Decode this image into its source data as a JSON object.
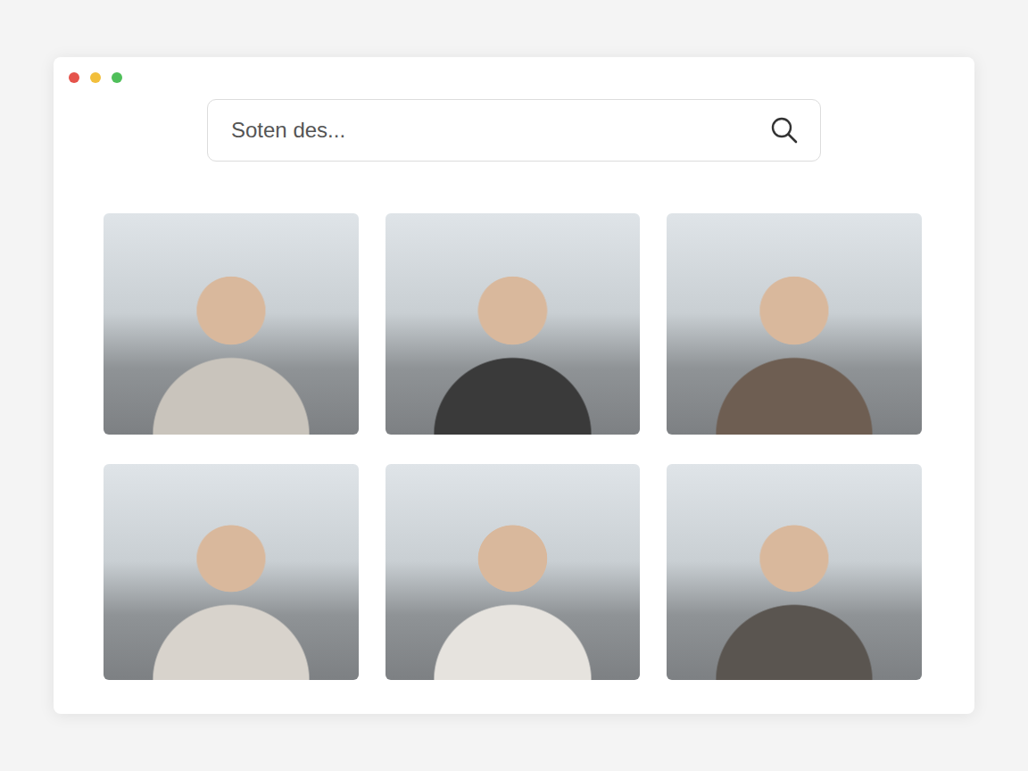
{
  "search": {
    "placeholder": "Soten des..."
  },
  "results": [
    {
      "color": "#c9c4bc"
    },
    {
      "color": "#3a3a3a"
    },
    {
      "color": "#6e5e52"
    },
    {
      "color": "#d8d3cc"
    },
    {
      "color": "#e6e3de"
    },
    {
      "color": "#5a5550"
    }
  ]
}
